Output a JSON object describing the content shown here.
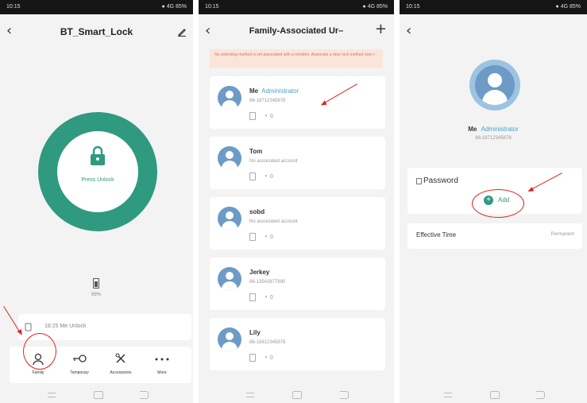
{
  "status_bar": {
    "left": "10:15",
    "right": "● 4G 85%"
  },
  "screen1": {
    "title": "BT_Smart_Lock",
    "unlock_label": "Press Unlock",
    "battery_label": "99%",
    "record_text": "18:25 Me Unlock",
    "bottom_nav": [
      {
        "label": "Family",
        "icon": "family-icon"
      },
      {
        "label": "Temporary",
        "icon": "key-icon"
      },
      {
        "label": "Accessories",
        "icon": "accessories-icon"
      },
      {
        "label": "More",
        "icon": "more-icon"
      }
    ]
  },
  "screen2": {
    "title": "Family-Associated Ur–",
    "notice": "No unlocking method is yet associated with a member. Associate a door lock method now >",
    "members": [
      {
        "name": "Me",
        "tag": "Administrator",
        "sub": "86-18712345678",
        "counts": [
          "0",
          "0"
        ]
      },
      {
        "name": "Tom",
        "tag": "",
        "sub": "No associated account",
        "counts": [
          "",
          "0"
        ]
      },
      {
        "name": "sobd",
        "tag": "",
        "sub": "No associated account",
        "counts": [
          "",
          "0"
        ]
      },
      {
        "name": "Jerkey",
        "tag": "",
        "sub": "86-13543877890",
        "counts": [
          "",
          "0"
        ]
      },
      {
        "name": "Lily",
        "tag": "",
        "sub": "86-18812345678",
        "counts": [
          "0",
          "0"
        ]
      }
    ]
  },
  "screen3": {
    "member_name": "Me",
    "member_tag": "Administrator",
    "member_phone": "86-18712345678",
    "password_label": "Password",
    "add_label": "Add",
    "effective_label": "Effective Time",
    "effective_value": "Permanent"
  },
  "colors": {
    "accent": "#2f9a80",
    "annotation": "#e02020",
    "avatar": "#6d9bc6"
  }
}
